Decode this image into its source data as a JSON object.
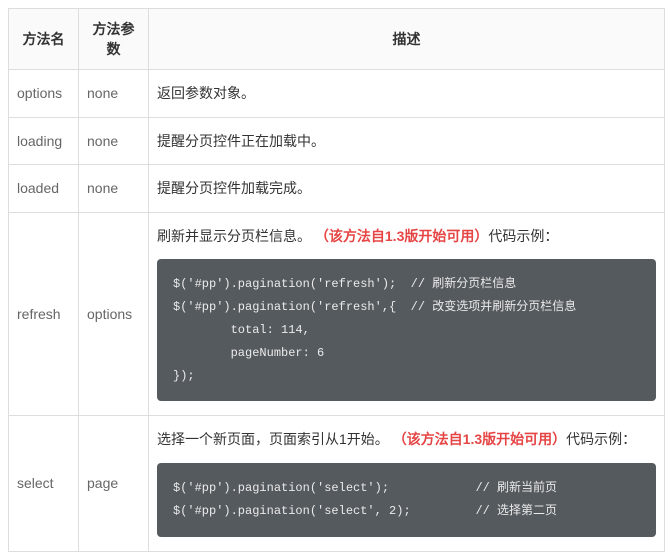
{
  "table": {
    "headers": {
      "method": "方法名",
      "param": "方法参数",
      "description": "描述"
    },
    "rows": [
      {
        "method": "options",
        "param": "none",
        "desc_text": "返回参数对象。",
        "note": "",
        "desc_suffix": "",
        "code": ""
      },
      {
        "method": "loading",
        "param": "none",
        "desc_text": "提醒分页控件正在加载中。",
        "note": "",
        "desc_suffix": "",
        "code": ""
      },
      {
        "method": "loaded",
        "param": "none",
        "desc_text": "提醒分页控件加载完成。",
        "note": "",
        "desc_suffix": "",
        "code": ""
      },
      {
        "method": "refresh",
        "param": "options",
        "desc_text": "刷新并显示分页栏信息。 ",
        "note": "（该方法自1.3版开始可用）",
        "desc_suffix": "代码示例：",
        "code": "$('#pp').pagination('refresh');  // 刷新分页栏信息\n$('#pp').pagination('refresh',{  // 改变选项并刷新分页栏信息\n        total: 114,\n        pageNumber: 6\n});"
      },
      {
        "method": "select",
        "param": "page",
        "desc_text": "选择一个新页面，页面索引从1开始。 ",
        "note": "（该方法自1.3版开始可用）",
        "desc_suffix": "代码示例：",
        "code": "$('#pp').pagination('select');            // 刷新当前页\n$('#pp').pagination('select', 2);         // 选择第二页"
      }
    ]
  }
}
